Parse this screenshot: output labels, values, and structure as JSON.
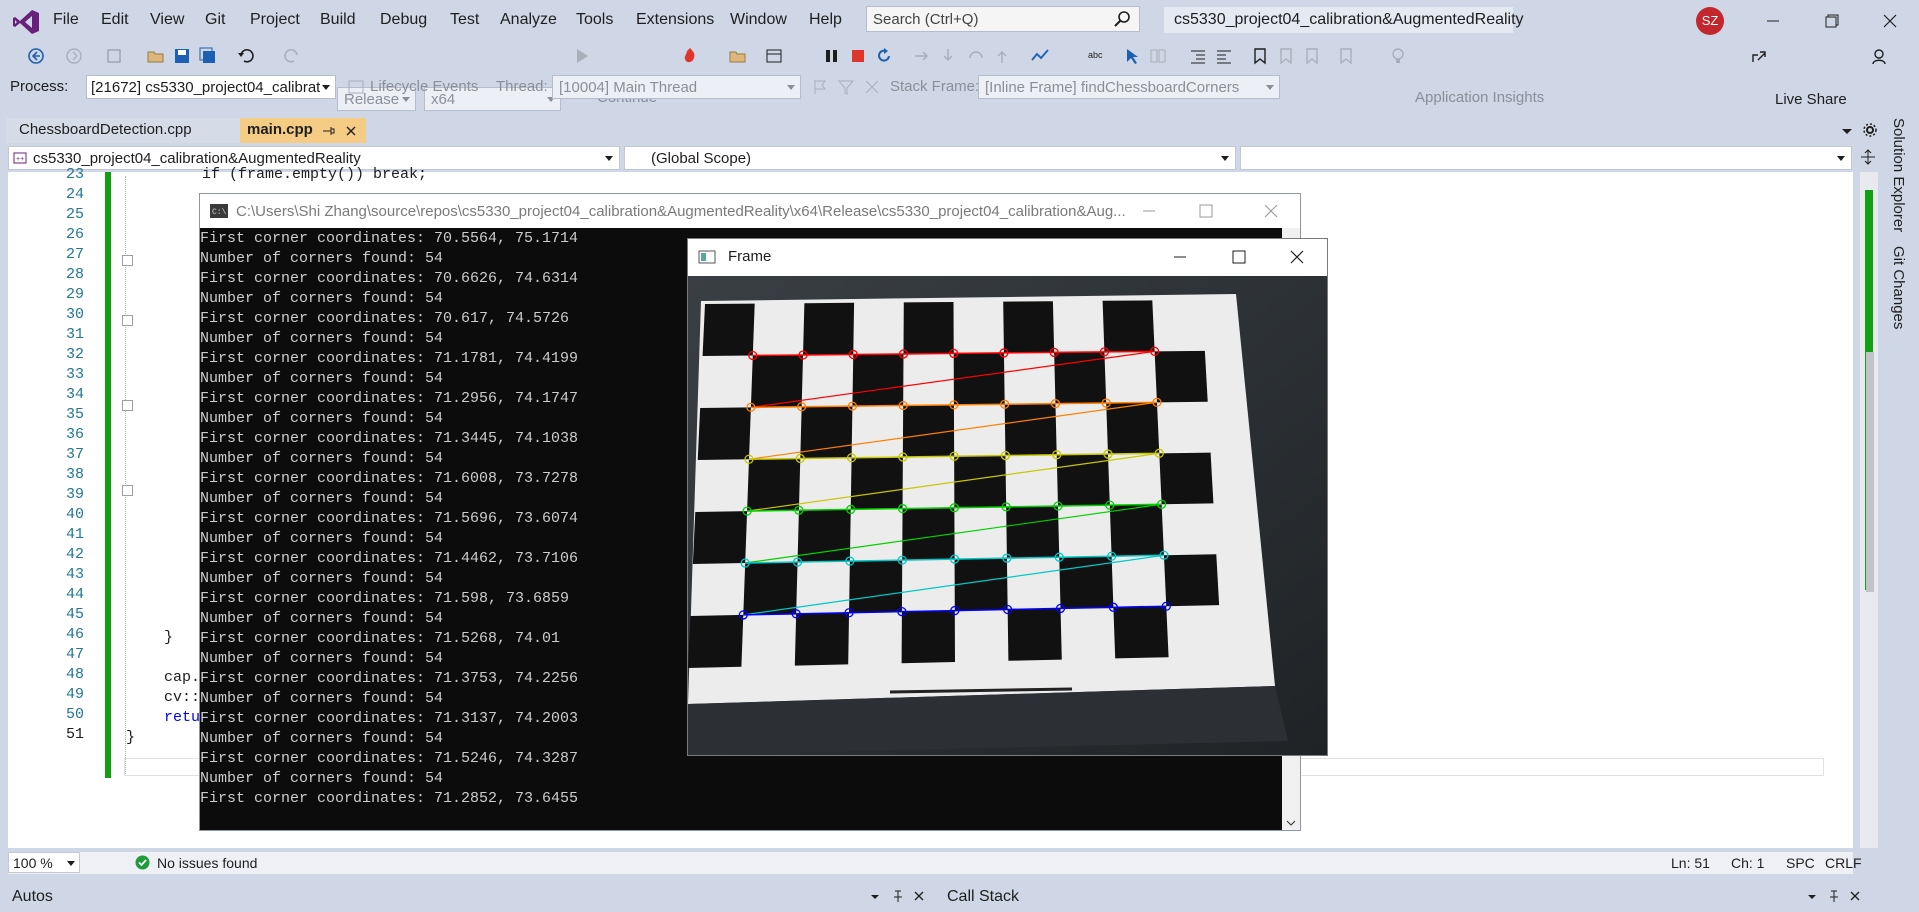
{
  "menubar": {
    "items": [
      "File",
      "Edit",
      "View",
      "Git",
      "Project",
      "Build",
      "Debug",
      "Test",
      "Analyze",
      "Tools",
      "Extensions",
      "Window",
      "Help"
    ],
    "search_placeholder": "Search (Ctrl+Q)",
    "solution_title": "cs5330_project04_calibration&AugmentedReality",
    "user_initials": "SZ"
  },
  "toolbar": {
    "config": "Release",
    "platform": "x64",
    "continue_label": "Continue",
    "app_insights_label": "Application Insights",
    "live_share_label": "Live Share"
  },
  "debug_toolbar": {
    "process_label": "Process:",
    "process_value": "[21672] cs5330_project04_calibrat",
    "lifecycle_label": "Lifecycle Events",
    "thread_label": "Thread:",
    "thread_value": "[10004] Main Thread",
    "stack_frame_label": "Stack Frame:",
    "stack_frame_value": "[Inline Frame] findChessboardCorners"
  },
  "tabs": [
    {
      "label": "ChessboardDetection.cpp",
      "active": false
    },
    {
      "label": "main.cpp",
      "active": true
    }
  ],
  "navbar": {
    "project": "cs5330_project04_calibration&AugmentedReality",
    "scope": "(Global Scope)",
    "member": ""
  },
  "editor": {
    "line_numbers": [
      "23",
      "24",
      "25",
      "26",
      "27",
      "28",
      "29",
      "30",
      "31",
      "32",
      "33",
      "34",
      "35",
      "36",
      "37",
      "38",
      "39",
      "40",
      "41",
      "42",
      "43",
      "44",
      "45",
      "46",
      "47",
      "48",
      "49",
      "50",
      "51"
    ],
    "visible_code": {
      "l23": "if (frame.empty()) break;",
      "l45": "}",
      "l47": "cap.",
      "l48": "cv::",
      "l49": "retu",
      "l50": "}"
    }
  },
  "console": {
    "title": "C:\\Users\\Shi Zhang\\source\\repos\\cs5330_project04_calibration&AugmentedReality\\x64\\Release\\cs5330_project04_calibration&Aug...",
    "lines": [
      "First corner coordinates: 70.5564, 75.1714",
      "Number of corners found: 54",
      "First corner coordinates: 70.6626, 74.6314",
      "Number of corners found: 54",
      "First corner coordinates: 70.617, 74.5726",
      "Number of corners found: 54",
      "First corner coordinates: 71.1781, 74.4199",
      "Number of corners found: 54",
      "First corner coordinates: 71.2956, 74.1747",
      "Number of corners found: 54",
      "First corner coordinates: 71.3445, 74.1038",
      "Number of corners found: 54",
      "First corner coordinates: 71.6008, 73.7278",
      "Number of corners found: 54",
      "First corner coordinates: 71.5696, 73.6074",
      "Number of corners found: 54",
      "First corner coordinates: 71.4462, 73.7106",
      "Number of corners found: 54",
      "First corner coordinates: 71.598, 73.6859",
      "Number of corners found: 54",
      "First corner coordinates: 71.5268, 74.01",
      "Number of corners found: 54",
      "First corner coordinates: 71.3753, 74.2256",
      "Number of corners found: 54",
      "First corner coordinates: 71.3137, 74.2003",
      "Number of corners found: 54",
      "First corner coordinates: 71.5246, 74.3287",
      "Number of corners found: 54",
      "First corner coordinates: 71.2852, 73.6455"
    ]
  },
  "frame_window": {
    "title": "Frame",
    "corner_grid": {
      "rows": 6,
      "cols": 9,
      "row_colors": [
        "#ff0000",
        "#ff8000",
        "#c8c800",
        "#00d000",
        "#00c8c8",
        "#0000ff"
      ]
    }
  },
  "status": {
    "zoom": "100 %",
    "issues": "No issues found",
    "line": "Ln: 51",
    "col": "Ch: 1",
    "spc": "SPC",
    "eol": "CRLF"
  },
  "bottom_panels": {
    "autos": "Autos",
    "call_stack": "Call Stack"
  },
  "right_rail": {
    "solution_explorer": "Solution Explorer",
    "git_changes": "Git Changes"
  }
}
